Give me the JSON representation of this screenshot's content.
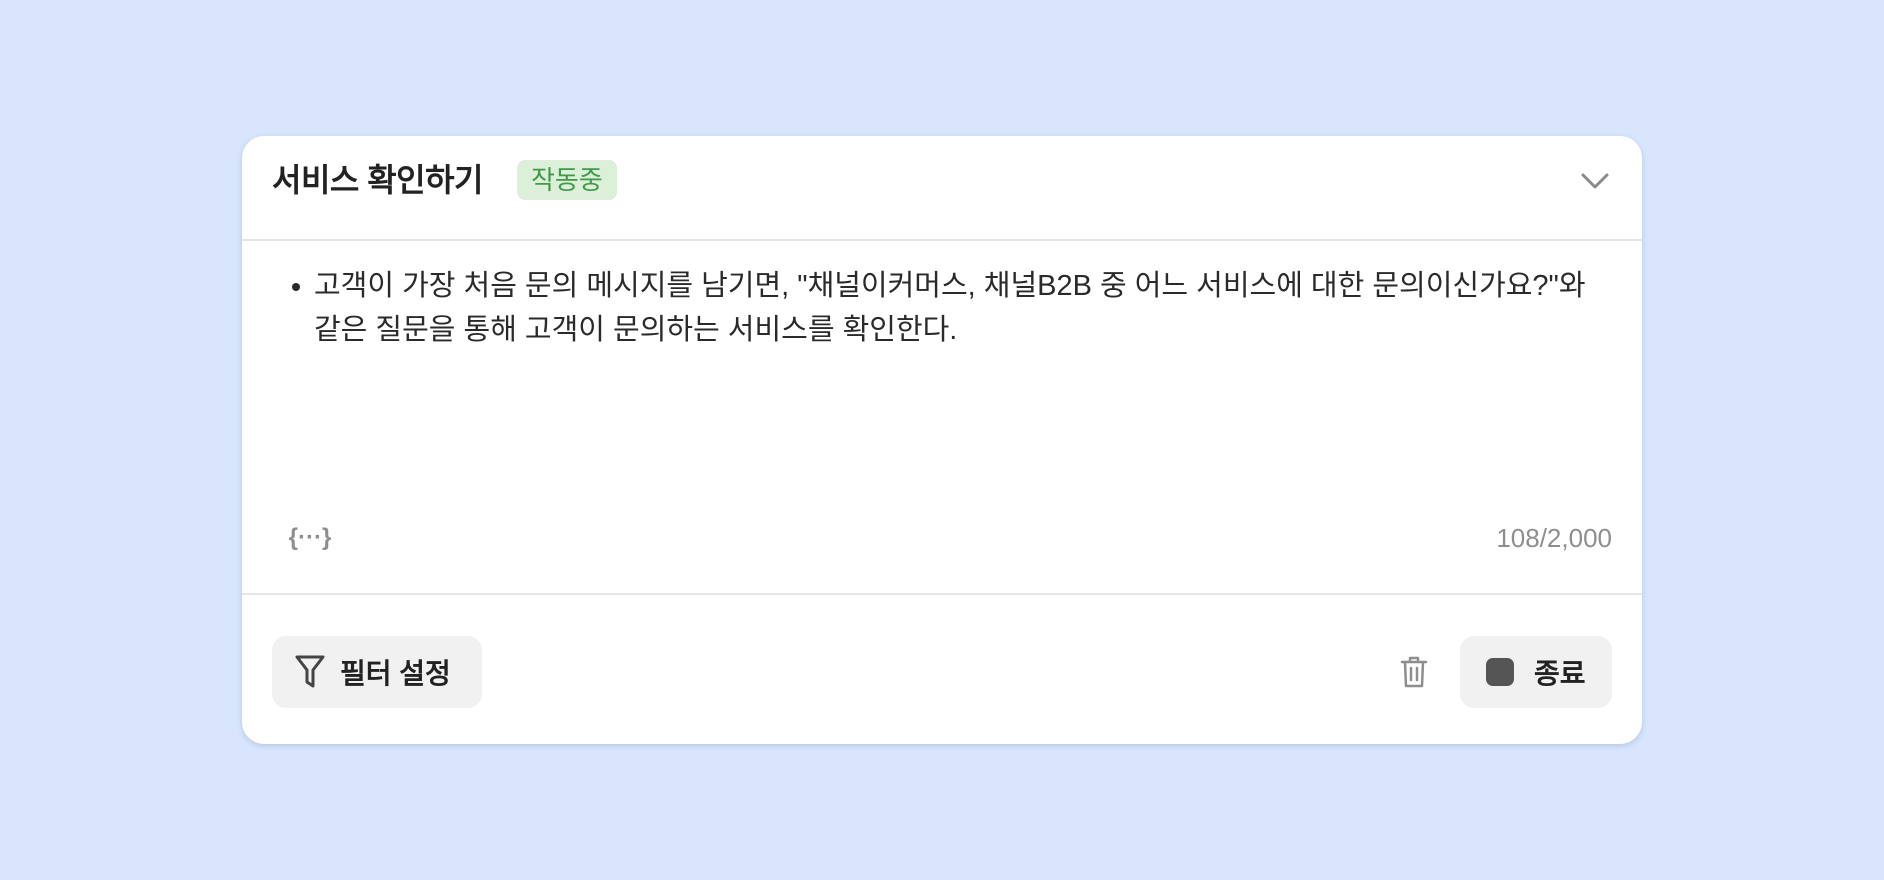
{
  "card": {
    "title": "서비스 확인하기",
    "status_badge": "작동중",
    "instructions": [
      "고객이 가장 처음 문의 메시지를 남기면, \"채널이커머스, 채널B2B 중 어느 서비스에 대한 문의이신가요?\"와 같은 질문을 통해 고객이 문의하는 서비스를 확인한다."
    ],
    "variable_button": "{···}",
    "char_count": "108/2,000",
    "filter_label": "필터 설정",
    "end_label": "종료"
  },
  "icons": {
    "collapse": "chevron-down-icon",
    "filter": "filter-icon",
    "delete": "trash-icon",
    "stop": "stop-icon"
  },
  "colors": {
    "background": "#d8e5fd",
    "badge_bg": "#dcefd9",
    "badge_text": "#3f9a4a",
    "button_bg": "#f1f1f1"
  }
}
